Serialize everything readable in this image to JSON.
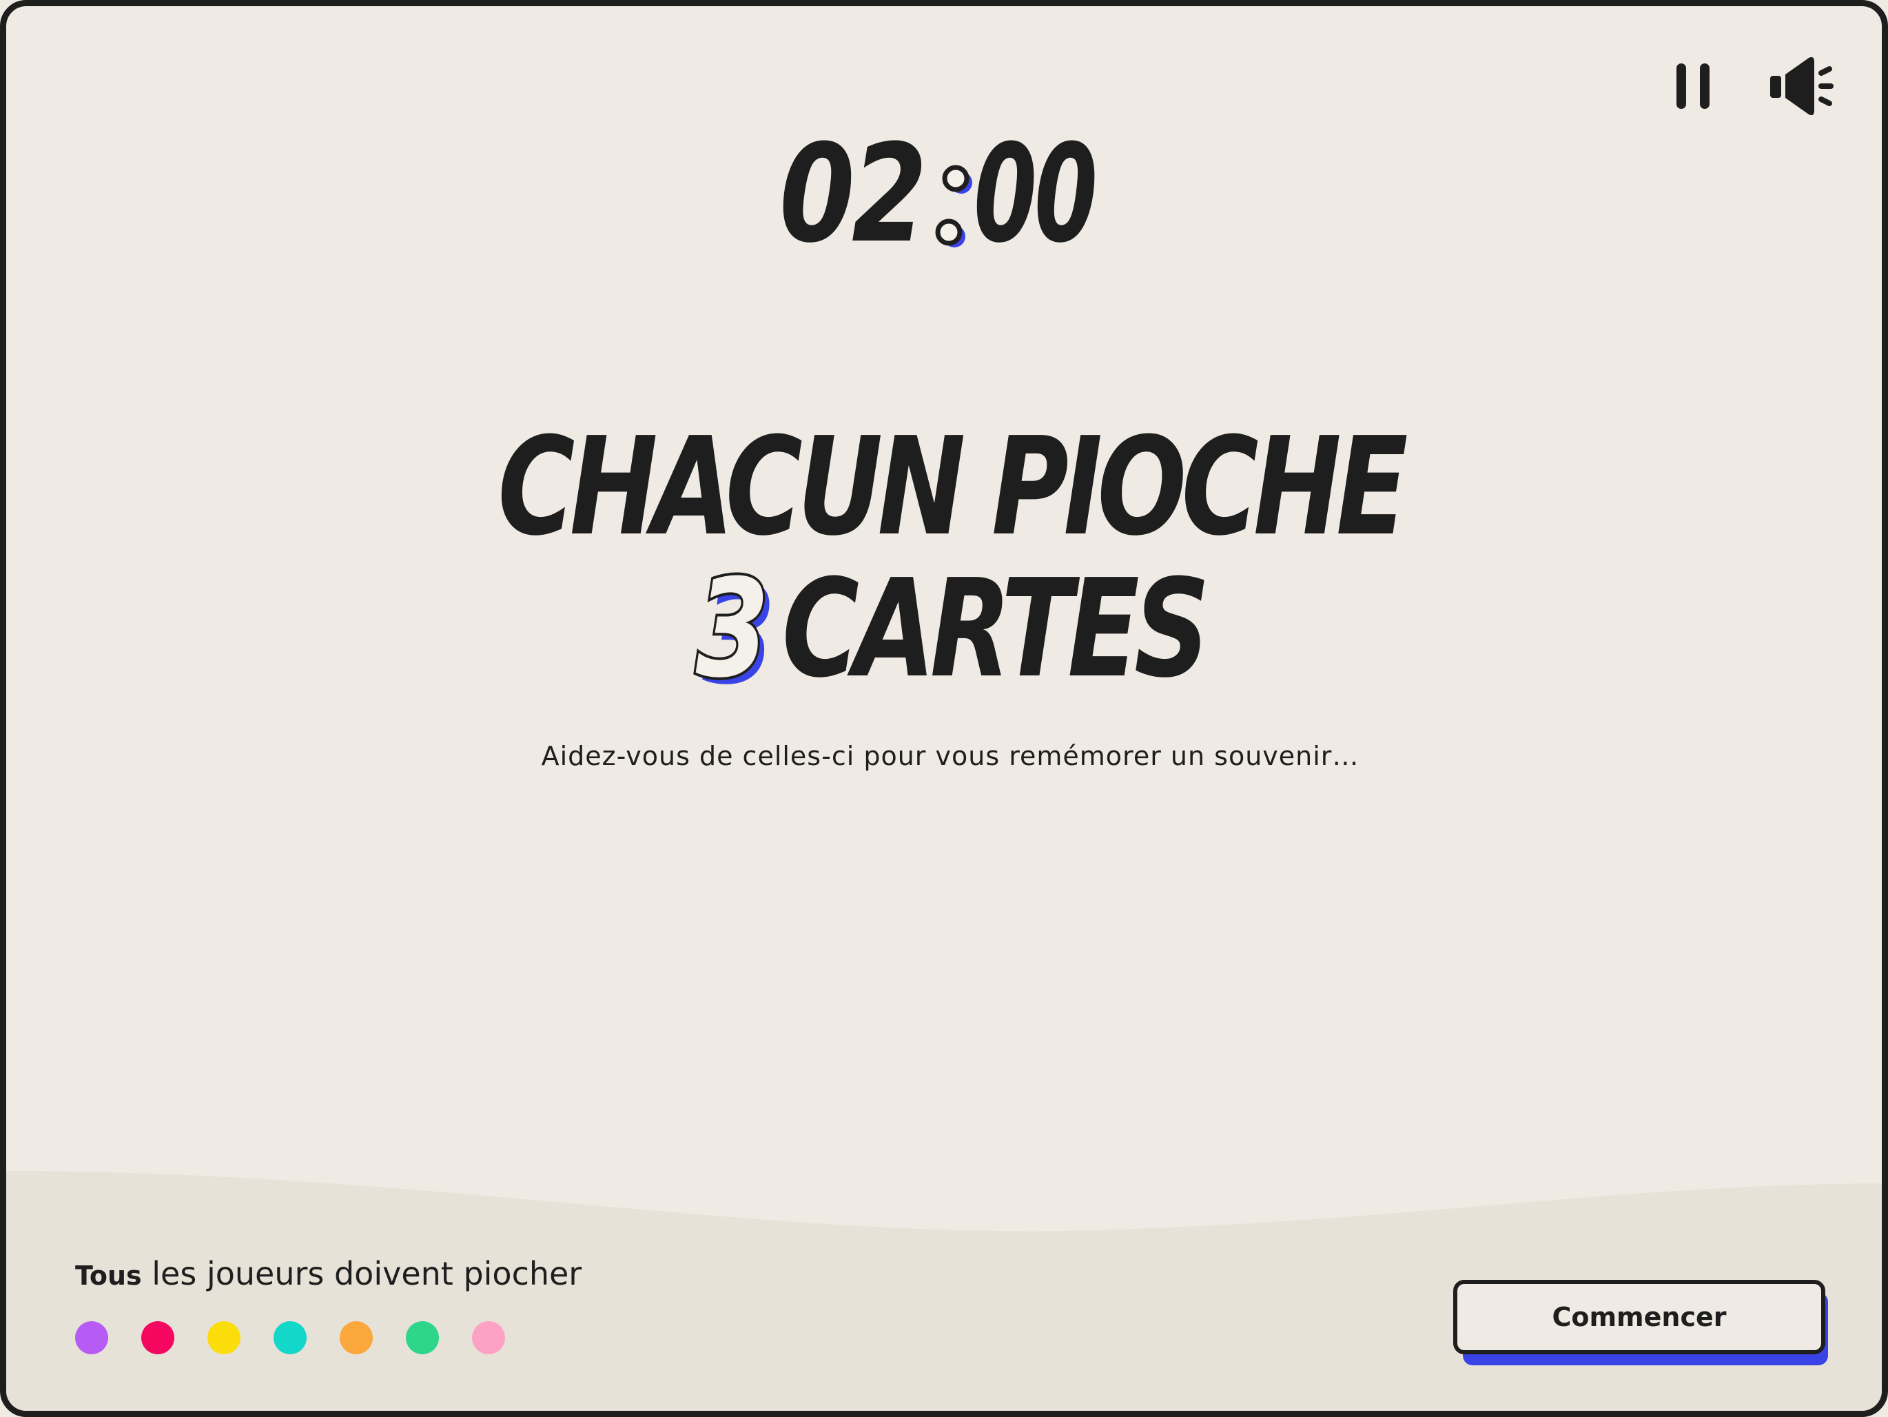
{
  "controls": {
    "pause_icon": "pause-icon",
    "sound_icon": "speaker-icon"
  },
  "timer": {
    "minutes": "02",
    "seconds": "00"
  },
  "title": {
    "line1": "CHACUN PIOCHE",
    "count": "3",
    "line2_word": "CARTES"
  },
  "subtitle": "Aidez-vous de celles-ci pour vous remémorer un souvenir…",
  "players": {
    "label_strong": "Tous",
    "label_rest": " les joueurs doivent piocher",
    "colors": [
      "#b65cf5",
      "#f5065f",
      "#fbdd0c",
      "#12d7c9",
      "#fba73c",
      "#2dd68b",
      "#fda2c4"
    ]
  },
  "start_button": {
    "label": "Commencer"
  },
  "colors": {
    "background": "#efebe4",
    "ink": "#1e1e1e",
    "accent": "#3a44e6",
    "band": "#e6e2d8"
  }
}
